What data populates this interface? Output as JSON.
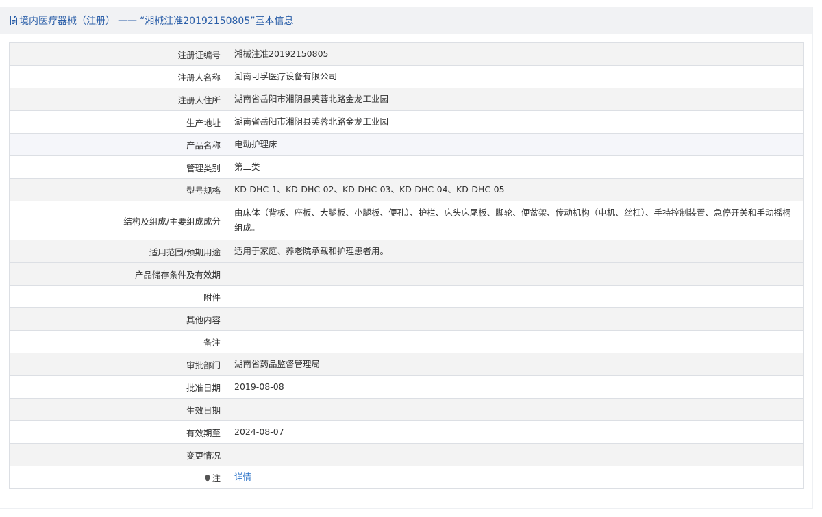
{
  "header": {
    "prefix": "境内医疗器械（注册）",
    "separator": "——",
    "title": "“湘械注准20192150805”基本信息"
  },
  "rows": [
    {
      "label": "注册证编号",
      "value": "湘械注准20192150805"
    },
    {
      "label": "注册人名称",
      "value": "湖南可孚医疗设备有限公司"
    },
    {
      "label": "注册人住所",
      "value": "湖南省岳阳市湘阴县芙蓉北路金龙工业园"
    },
    {
      "label": "生产地址",
      "value": "湖南省岳阳市湘阴县芙蓉北路金龙工业园"
    },
    {
      "label": "产品名称",
      "value": "电动护理床"
    },
    {
      "label": "管理类别",
      "value": "第二类"
    },
    {
      "label": "型号规格",
      "value": "KD-DHC-1、KD-DHC-02、KD-DHC-03、KD-DHC-04、KD-DHC-05"
    },
    {
      "label": "结构及组成/主要组成成分",
      "value": "由床体（背板、座板、大腿板、小腿板、便孔）、护栏、床头床尾板、脚轮、便盆架、传动机构（电机、丝杠）、手持控制装置、急停开关和手动摇柄组成。"
    },
    {
      "label": "适用范围/预期用途",
      "value": "适用于家庭、养老院承载和护理患者用。"
    },
    {
      "label": "产品储存条件及有效期",
      "value": ""
    },
    {
      "label": "附件",
      "value": ""
    },
    {
      "label": "其他内容",
      "value": ""
    },
    {
      "label": "备注",
      "value": ""
    },
    {
      "label": "审批部门",
      "value": "湖南省药品监督管理局"
    },
    {
      "label": "批准日期",
      "value": "2019-08-08"
    },
    {
      "label": "生效日期",
      "value": ""
    },
    {
      "label": "有效期至",
      "value": "2024-08-07"
    },
    {
      "label": "变更情况",
      "value": ""
    }
  ],
  "note": {
    "label": "注",
    "link": "详情"
  },
  "colors": {
    "header_text": "#2a5ea8",
    "link": "#2a72c8",
    "border": "#dcdfe4",
    "stripe": "#f3f3f3"
  }
}
